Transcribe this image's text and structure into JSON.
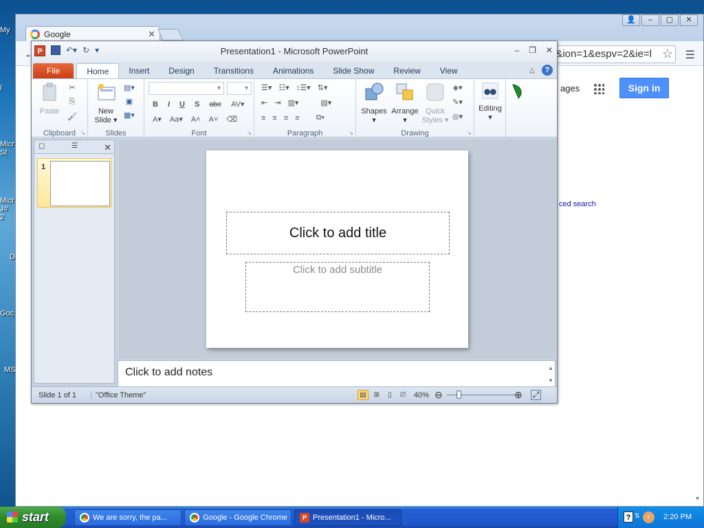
{
  "desktop": {
    "labels": [
      "My",
      "I",
      "Micr St",
      "Micr J# 2",
      "D",
      "Goc",
      "MS"
    ]
  },
  "chrome": {
    "tab_title": "Google",
    "address_text": "&ion=1&espv=2&ie=l",
    "images_link": "ages",
    "signin_label": "Sign in",
    "adv_search": "ced search"
  },
  "ppt": {
    "window_title": "Presentation1  -  Microsoft PowerPoint",
    "tabs": [
      "File",
      "Home",
      "Insert",
      "Design",
      "Transitions",
      "Animations",
      "Slide Show",
      "Review",
      "View"
    ],
    "groups": {
      "clipboard": "Clipboard",
      "slides": "Slides",
      "font": "Font",
      "paragraph": "Paragraph",
      "drawing": "Drawing"
    },
    "buttons": {
      "paste": "Paste",
      "new_slide_1": "New",
      "new_slide_2": "Slide",
      "shapes": "Shapes",
      "arrange": "Arrange",
      "quick_styles_1": "Quick",
      "quick_styles_2": "Styles",
      "editing": "Editing"
    },
    "slide_number": "1",
    "title_placeholder": "Click to add title",
    "subtitle_placeholder": "Click to add subtitle",
    "notes_placeholder": "Click to add notes",
    "status": {
      "slide_info": "Slide 1 of 1",
      "theme": "\"Office Theme\"",
      "zoom": "40%"
    }
  },
  "taskbar": {
    "start_label": "start",
    "items": [
      {
        "label": "We are sorry, the pa..."
      },
      {
        "label": "Google - Google Chrome"
      },
      {
        "label": "Presentation1 - Micro..."
      }
    ],
    "clock": "2:20 PM"
  }
}
